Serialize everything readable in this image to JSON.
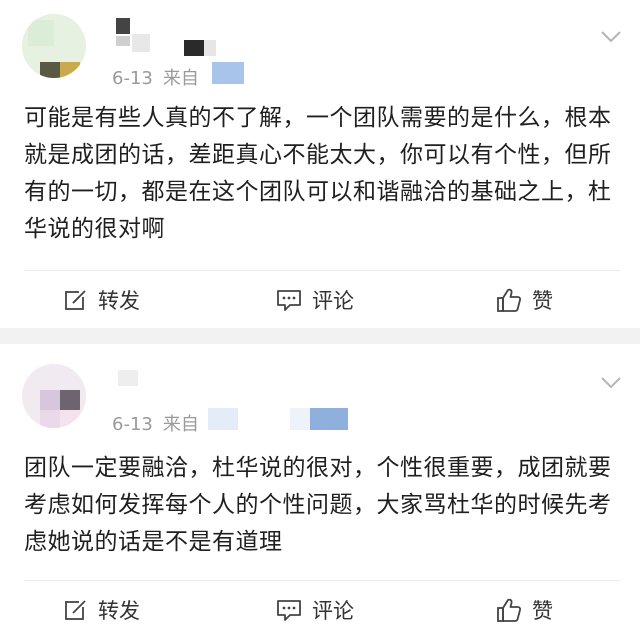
{
  "posts": [
    {
      "date": "6-13",
      "source_prefix": "来自",
      "content": "可能是有些人真的不了解，一个团队需要的是什么，根本就是成团的话，差距真心不能太大，你可以有个性，但所有的一切，都是在这个团队可以和谐融洽的基础之上，杜华说的很对啊",
      "actions": {
        "repost": "转发",
        "comment": "评论",
        "like": "赞"
      }
    },
    {
      "date": "6-13",
      "source_prefix": "来自",
      "content": "团队一定要融洽，杜华说的很对，个性很重要，成团就要考虑如何发挥每个人的个性问题，大家骂杜华的时候先考虑她说的话是不是有道理",
      "actions": {
        "repost": "转发",
        "comment": "评论",
        "like": "赞"
      }
    }
  ],
  "icons": {
    "repost": "edit-share-icon",
    "comment": "comment-bubble-icon",
    "like": "thumbs-up-icon",
    "menu": "chevron-down-icon"
  },
  "colors": {
    "background": "#f2f2f2",
    "card": "#ffffff",
    "meta_text": "#9a9a9a",
    "body_text": "#1f1f1f",
    "blur_blue": "#8fb3e0"
  }
}
